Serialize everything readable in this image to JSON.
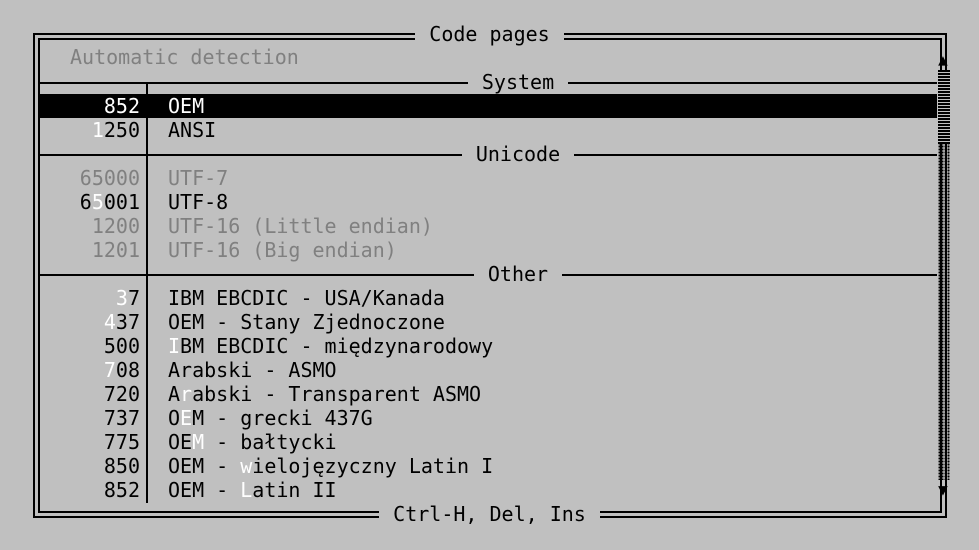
{
  "dialog": {
    "title": "Code pages",
    "auto_detect": "Automatic detection",
    "footer": "Ctrl-H, Del, Ins"
  },
  "sections": {
    "system": "System",
    "unicode": "Unicode",
    "other": "Other"
  },
  "rows": [
    {
      "code_pre": "",
      "code_hk": "8",
      "code_post": "52",
      "name_pre": "OEM",
      "name_hk": "",
      "name_post": ""
    },
    {
      "code_pre": "",
      "code_hk": "1",
      "code_post": "250",
      "name_pre": "ANSI",
      "name_hk": "",
      "name_post": ""
    },
    {
      "code_pre": "65000",
      "code_hk": "",
      "code_post": "",
      "name_pre": "UTF-7",
      "name_hk": "",
      "name_post": ""
    },
    {
      "code_pre": "6",
      "code_hk": "5",
      "code_post": "001",
      "name_pre": "UTF-8",
      "name_hk": "",
      "name_post": ""
    },
    {
      "code_pre": "1200",
      "code_hk": "",
      "code_post": "",
      "name_pre": "UTF-16 (Little endian)",
      "name_hk": "",
      "name_post": ""
    },
    {
      "code_pre": "1201",
      "code_hk": "",
      "code_post": "",
      "name_pre": "UTF-16 (Big endian)",
      "name_hk": "",
      "name_post": ""
    },
    {
      "code_pre": "",
      "code_hk": "3",
      "code_post": "7",
      "name_pre": "IBM EBCDIC - USA/Kanada",
      "name_hk": "",
      "name_post": ""
    },
    {
      "code_pre": "",
      "code_hk": "4",
      "code_post": "37",
      "name_pre": "OEM - Stany Zjednoczone",
      "name_hk": "",
      "name_post": ""
    },
    {
      "code_pre": "500",
      "code_hk": "",
      "code_post": "",
      "name_pre": "",
      "name_hk": "I",
      "name_post": "BM EBCDIC - międzynarodowy"
    },
    {
      "code_pre": "",
      "code_hk": "7",
      "code_post": "08",
      "name_pre": "Arabski - ASMO",
      "name_hk": "",
      "name_post": ""
    },
    {
      "code_pre": "720",
      "code_hk": "",
      "code_post": "",
      "name_pre": "A",
      "name_hk": "r",
      "name_post": "abski - Transparent ASMO"
    },
    {
      "code_pre": "737",
      "code_hk": "",
      "code_post": "",
      "name_pre": "O",
      "name_hk": "E",
      "name_post": "M - grecki 437G"
    },
    {
      "code_pre": "775",
      "code_hk": "",
      "code_post": "",
      "name_pre": "OE",
      "name_hk": "M",
      "name_post": " - bałtycki"
    },
    {
      "code_pre": "850",
      "code_hk": "",
      "code_post": "",
      "name_pre": "OEM - ",
      "name_hk": "w",
      "name_post": "ielojęzyczny Latin I"
    },
    {
      "code_pre": "852",
      "code_hk": "",
      "code_post": "",
      "name_pre": "OEM - ",
      "name_hk": "L",
      "name_post": "atin II"
    }
  ],
  "scrollbar": {
    "up": "▲",
    "down": "▼",
    "position_fraction": 0.0
  }
}
